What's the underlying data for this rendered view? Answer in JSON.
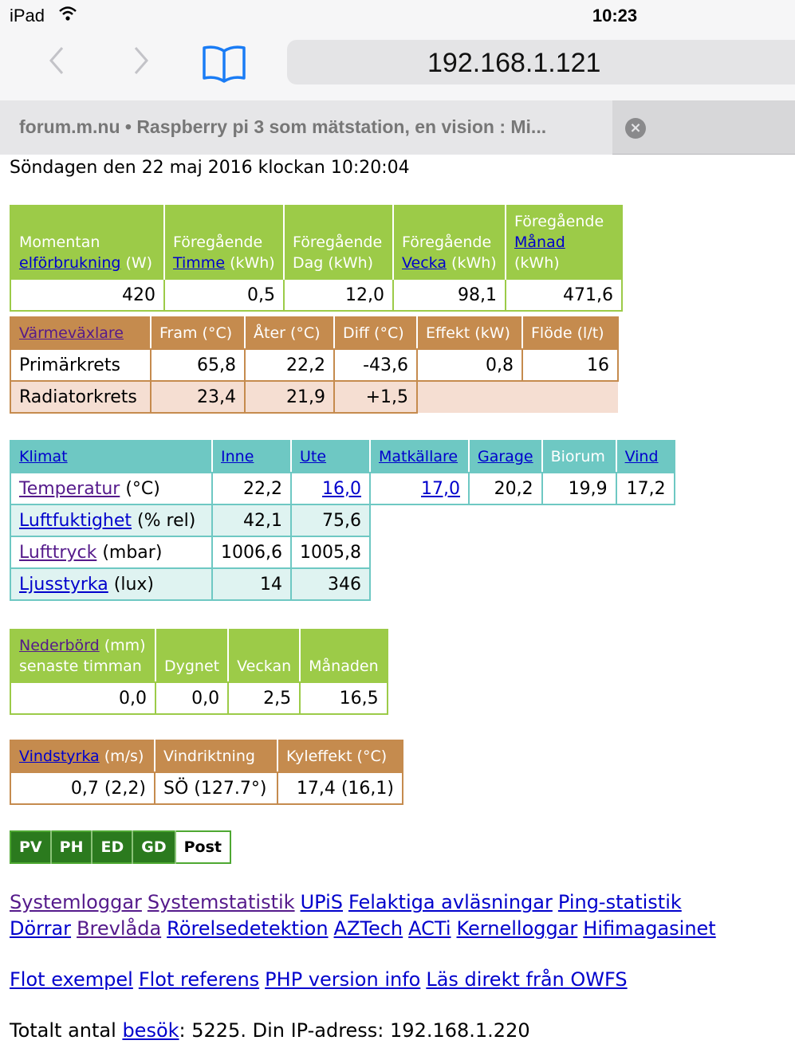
{
  "status_bar": {
    "device": "iPad",
    "time": "10:23"
  },
  "browser": {
    "url": "192.168.1.121",
    "tab_title": "forum.m.nu • Raspberry pi 3 som mätstation, en vision : Mi..."
  },
  "page": {
    "date_line": "Söndagen den 22 maj 2016 klockan 10:20:04",
    "electricity": {
      "h1": {
        "pre": "Momentan",
        "link": "elförbrukning",
        "unit": "(W)"
      },
      "h2": {
        "pre": "Föregående",
        "link": "Timme",
        "unit": "(kWh)"
      },
      "h3": {
        "pre": "Föregående",
        "line2": "Dag (kWh)"
      },
      "h4": {
        "pre": "Föregående",
        "link": "Vecka",
        "unit": "(kWh)"
      },
      "h5": {
        "pre": "Föregående",
        "link": "Månad",
        "unit": "(kWh)"
      },
      "values": [
        "420",
        "0,5",
        "12,0",
        "98,1",
        "471,6"
      ]
    },
    "heat_exchanger": {
      "title_link": "Värmeväxlare",
      "headers": [
        "Fram (°C)",
        "Åter (°C)",
        "Diff (°C)",
        "Effekt (kW)",
        "Flöde (l/t)"
      ],
      "rows": [
        {
          "label": "Primärkrets",
          "values": [
            "65,8",
            "22,2",
            "-43,6",
            "0,8",
            "16"
          ]
        },
        {
          "label": "Radiatorkrets",
          "values": [
            "23,4",
            "21,9",
            "+1,5"
          ]
        }
      ]
    },
    "climate": {
      "headers": [
        "Klimat",
        "Inne",
        "Ute",
        "Matkällare",
        "Garage",
        "Biorum",
        "Vind"
      ],
      "rows": [
        {
          "label_link": "Temperatur",
          "unit": "(°C)",
          "values": [
            "22,2",
            "16,0",
            "17,0",
            "20,2",
            "19,9",
            "17,2"
          ]
        },
        {
          "label_link": "Luftfuktighet",
          "unit": "(% rel)",
          "values": [
            "42,1",
            "75,6"
          ]
        },
        {
          "label_link": "Lufttryck",
          "unit": "(mbar)",
          "values": [
            "1006,6",
            "1005,8"
          ]
        },
        {
          "label_link": "Ljusstyrka",
          "unit": "(lux)",
          "values": [
            "14",
            "346"
          ]
        }
      ]
    },
    "precipitation": {
      "title_link": "Nederbörd",
      "title_unit": "(mm)",
      "title_line2": "senaste timman",
      "headers": [
        "Dygnet",
        "Veckan",
        "Månaden"
      ],
      "values": [
        "0,0",
        "0,0",
        "2,5",
        "16,5"
      ]
    },
    "wind": {
      "title_link": "Vindstyrka",
      "title_unit": "(m/s)",
      "headers": [
        "Vindriktning",
        "Kyleffekt (°C)"
      ],
      "values": [
        "0,7 (2,2)",
        "SÖ (127.7°)",
        "17,4 (16,1)"
      ]
    },
    "buttons": [
      "PV",
      "PH",
      "ED",
      "GD",
      "Post"
    ],
    "links_row1": [
      "Systemloggar",
      "Systemstatistik",
      "UPiS",
      "Felaktiga avläsningar",
      "Ping-statistik"
    ],
    "links_row2": [
      "Dörrar",
      "Brevlåda",
      "Rörelsedetektion",
      "AZTech",
      "ACTi",
      "Kernelloggar",
      "Hifimagasinet"
    ],
    "links_row3": [
      "Flot exempel",
      "Flot referens",
      "PHP version info",
      "Läs direkt från OWFS"
    ],
    "footer": {
      "pre": "Totalt antal",
      "link": "besök",
      "post": ": 5225. Din IP-adress: 192.168.1.220"
    }
  },
  "colors": {
    "green_header": "#9ccb48",
    "brown_header": "#c58b4e",
    "teal_header": "#6ec8c3",
    "button_green": "#2b7a1e",
    "link_blue": "#0000cc",
    "link_visited": "#551a8b"
  }
}
